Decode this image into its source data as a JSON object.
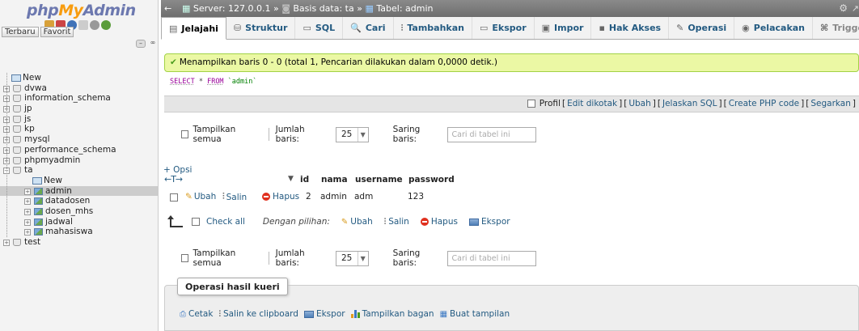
{
  "sidebar": {
    "logo": {
      "php": "php",
      "my": "My",
      "admin": "Admin"
    },
    "tabs": {
      "recent": "Terbaru",
      "favorite": "Favorit"
    },
    "tree": [
      {
        "label": "New",
        "level": 0,
        "kind": "new"
      },
      {
        "label": "dvwa",
        "level": 0,
        "kind": "db"
      },
      {
        "label": "information_schema",
        "level": 0,
        "kind": "db"
      },
      {
        "label": "jp",
        "level": 0,
        "kind": "db"
      },
      {
        "label": "js",
        "level": 0,
        "kind": "db"
      },
      {
        "label": "kp",
        "level": 0,
        "kind": "db"
      },
      {
        "label": "mysql",
        "level": 0,
        "kind": "db"
      },
      {
        "label": "performance_schema",
        "level": 0,
        "kind": "db"
      },
      {
        "label": "phpmyadmin",
        "level": 0,
        "kind": "db"
      },
      {
        "label": "ta",
        "level": 0,
        "kind": "db",
        "expanded": true
      },
      {
        "label": "New",
        "level": 1,
        "kind": "new"
      },
      {
        "label": "admin",
        "level": 1,
        "kind": "table",
        "selected": true
      },
      {
        "label": "datadosen",
        "level": 1,
        "kind": "table"
      },
      {
        "label": "dosen_mhs",
        "level": 1,
        "kind": "table"
      },
      {
        "label": "jadwal",
        "level": 1,
        "kind": "table"
      },
      {
        "label": "mahasiswa",
        "level": 1,
        "kind": "table"
      },
      {
        "label": "test",
        "level": 0,
        "kind": "db"
      }
    ]
  },
  "breadcrumb": {
    "server_label": "Server: 127.0.0.1",
    "sep1": "»",
    "database_label": "Basis data: ta",
    "sep2": "»",
    "table_label": "Tabel: admin"
  },
  "tabs": [
    {
      "label": "Jelajahi",
      "icon": "browse-icon",
      "glyph": "▤"
    },
    {
      "label": "Struktur",
      "icon": "structure-icon",
      "glyph": "⛁"
    },
    {
      "label": "SQL",
      "icon": "sql-icon",
      "glyph": "▭"
    },
    {
      "label": "Cari",
      "icon": "search-icon",
      "glyph": "🔍"
    },
    {
      "label": "Tambahkan",
      "icon": "insert-icon",
      "glyph": "⫶"
    },
    {
      "label": "Ekspor",
      "icon": "export-icon",
      "glyph": "▭"
    },
    {
      "label": "Impor",
      "icon": "import-icon",
      "glyph": "▣"
    },
    {
      "label": "Hak Akses",
      "icon": "privileges-icon",
      "glyph": "▪"
    },
    {
      "label": "Operasi",
      "icon": "operations-icon",
      "glyph": "✎"
    },
    {
      "label": "Pelacakan",
      "icon": "tracking-icon",
      "glyph": "◉"
    },
    {
      "label": "Trigger",
      "icon": "trigger-icon",
      "glyph": "⌘"
    }
  ],
  "success_message": "Menampilkan baris 0 - 0 (total 1, Pencarian dilakukan dalam 0,0000 detik.)",
  "sql_query": {
    "select": "SELECT",
    "star": " * ",
    "from": "FROM",
    "table": " `admin`"
  },
  "sql_links": {
    "profile": "Profil",
    "items": [
      "Edit dikotak",
      "Ubah",
      "Jelaskan SQL",
      "Create PHP code",
      "Segarkan"
    ]
  },
  "navigation": {
    "show_all": "Tampilkan semua",
    "rows_label": "Jumlah baris:",
    "rows_value": "25",
    "filter_label": "Saring baris:",
    "filter_placeholder": "Cari di tabel ini"
  },
  "results": {
    "options_label": "+ Opsi",
    "arrows": "←T→",
    "columns": [
      "id",
      "nama",
      "username",
      "password"
    ],
    "row_actions": {
      "edit": "Ubah",
      "copy": "Salin",
      "delete": "Hapus"
    },
    "rows": [
      {
        "id": "2",
        "nama": "admin",
        "username": "adm",
        "password": "123"
      }
    ],
    "check_all": "Check all",
    "with_selected": "Dengan pilihan:",
    "bulk": {
      "edit": "Ubah",
      "copy": "Salin",
      "delete": "Hapus",
      "export": "Ekspor"
    }
  },
  "query_ops": {
    "title": "Operasi hasil kueri",
    "actions": [
      "Cetak",
      "Salin ke clipboard",
      "Ekspor",
      "Tampilkan bagan",
      "Buat tampilan"
    ]
  },
  "colors": {
    "link": "#235a81",
    "success_bg": "#ebf8a4",
    "success_border": "#a2d246",
    "breadcrumb_bg": "#7a7a7a"
  }
}
